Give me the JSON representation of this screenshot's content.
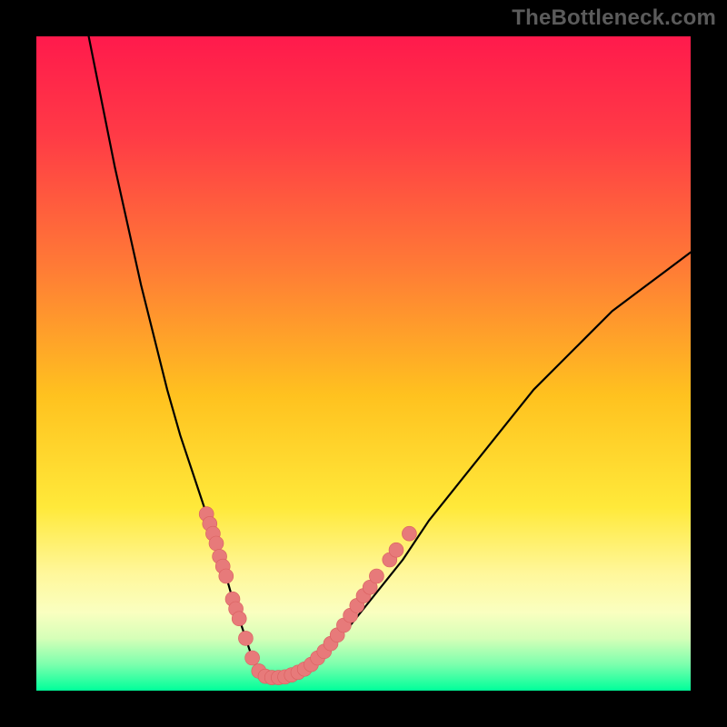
{
  "attribution": "TheBottleneck.com",
  "colors": {
    "frame": "#000000",
    "gradient_stops": [
      {
        "offset": 0.0,
        "color": "#ff1a4c"
      },
      {
        "offset": 0.15,
        "color": "#ff3a46"
      },
      {
        "offset": 0.35,
        "color": "#ff7a36"
      },
      {
        "offset": 0.55,
        "color": "#ffc21f"
      },
      {
        "offset": 0.72,
        "color": "#ffe93a"
      },
      {
        "offset": 0.82,
        "color": "#fff79a"
      },
      {
        "offset": 0.88,
        "color": "#faffc0"
      },
      {
        "offset": 0.92,
        "color": "#d6ffb8"
      },
      {
        "offset": 0.96,
        "color": "#7cffad"
      },
      {
        "offset": 1.0,
        "color": "#00ff9a"
      }
    ],
    "curve": "#000000",
    "marker_fill": "#e77a7a",
    "marker_stroke": "#d95f5f"
  },
  "chart_data": {
    "type": "line",
    "title": "",
    "xlabel": "",
    "ylabel": "",
    "xlim": [
      0,
      100
    ],
    "ylim": [
      0,
      100
    ],
    "grid": false,
    "legend": false,
    "series": [
      {
        "name": "curve",
        "x": [
          8,
          10,
          12,
          14,
          16,
          18,
          20,
          22,
          24,
          26,
          28,
          30,
          32,
          33,
          34,
          35,
          36,
          38,
          40,
          44,
          48,
          52,
          56,
          60,
          64,
          68,
          72,
          76,
          80,
          84,
          88,
          92,
          96,
          100
        ],
        "y": [
          100,
          90,
          80,
          71,
          62,
          54,
          46,
          39,
          33,
          27,
          21,
          14,
          8,
          5,
          3,
          2,
          2,
          2,
          3,
          6,
          10,
          15,
          20,
          26,
          31,
          36,
          41,
          46,
          50,
          54,
          58,
          61,
          64,
          67
        ]
      }
    ],
    "markers": [
      {
        "x": 26.0,
        "y": 27.0
      },
      {
        "x": 26.5,
        "y": 25.5
      },
      {
        "x": 27.0,
        "y": 24.0
      },
      {
        "x": 27.5,
        "y": 22.5
      },
      {
        "x": 28.0,
        "y": 20.5
      },
      {
        "x": 28.5,
        "y": 19.0
      },
      {
        "x": 29.0,
        "y": 17.5
      },
      {
        "x": 30.0,
        "y": 14.0
      },
      {
        "x": 30.5,
        "y": 12.5
      },
      {
        "x": 31.0,
        "y": 11.0
      },
      {
        "x": 32.0,
        "y": 8.0
      },
      {
        "x": 33.0,
        "y": 5.0
      },
      {
        "x": 34.0,
        "y": 3.0
      },
      {
        "x": 35.0,
        "y": 2.2
      },
      {
        "x": 36.0,
        "y": 2.0
      },
      {
        "x": 37.0,
        "y": 2.0
      },
      {
        "x": 38.0,
        "y": 2.1
      },
      {
        "x": 39.0,
        "y": 2.4
      },
      {
        "x": 40.0,
        "y": 2.8
      },
      {
        "x": 41.0,
        "y": 3.3
      },
      {
        "x": 42.0,
        "y": 4.0
      },
      {
        "x": 43.0,
        "y": 5.0
      },
      {
        "x": 44.0,
        "y": 6.0
      },
      {
        "x": 45.0,
        "y": 7.2
      },
      {
        "x": 46.0,
        "y": 8.5
      },
      {
        "x": 47.0,
        "y": 10.0
      },
      {
        "x": 48.0,
        "y": 11.5
      },
      {
        "x": 49.0,
        "y": 13.0
      },
      {
        "x": 50.0,
        "y": 14.5
      },
      {
        "x": 51.0,
        "y": 15.8
      },
      {
        "x": 52.0,
        "y": 17.5
      },
      {
        "x": 54.0,
        "y": 20.0
      },
      {
        "x": 55.0,
        "y": 21.5
      },
      {
        "x": 57.0,
        "y": 24.0
      }
    ]
  }
}
